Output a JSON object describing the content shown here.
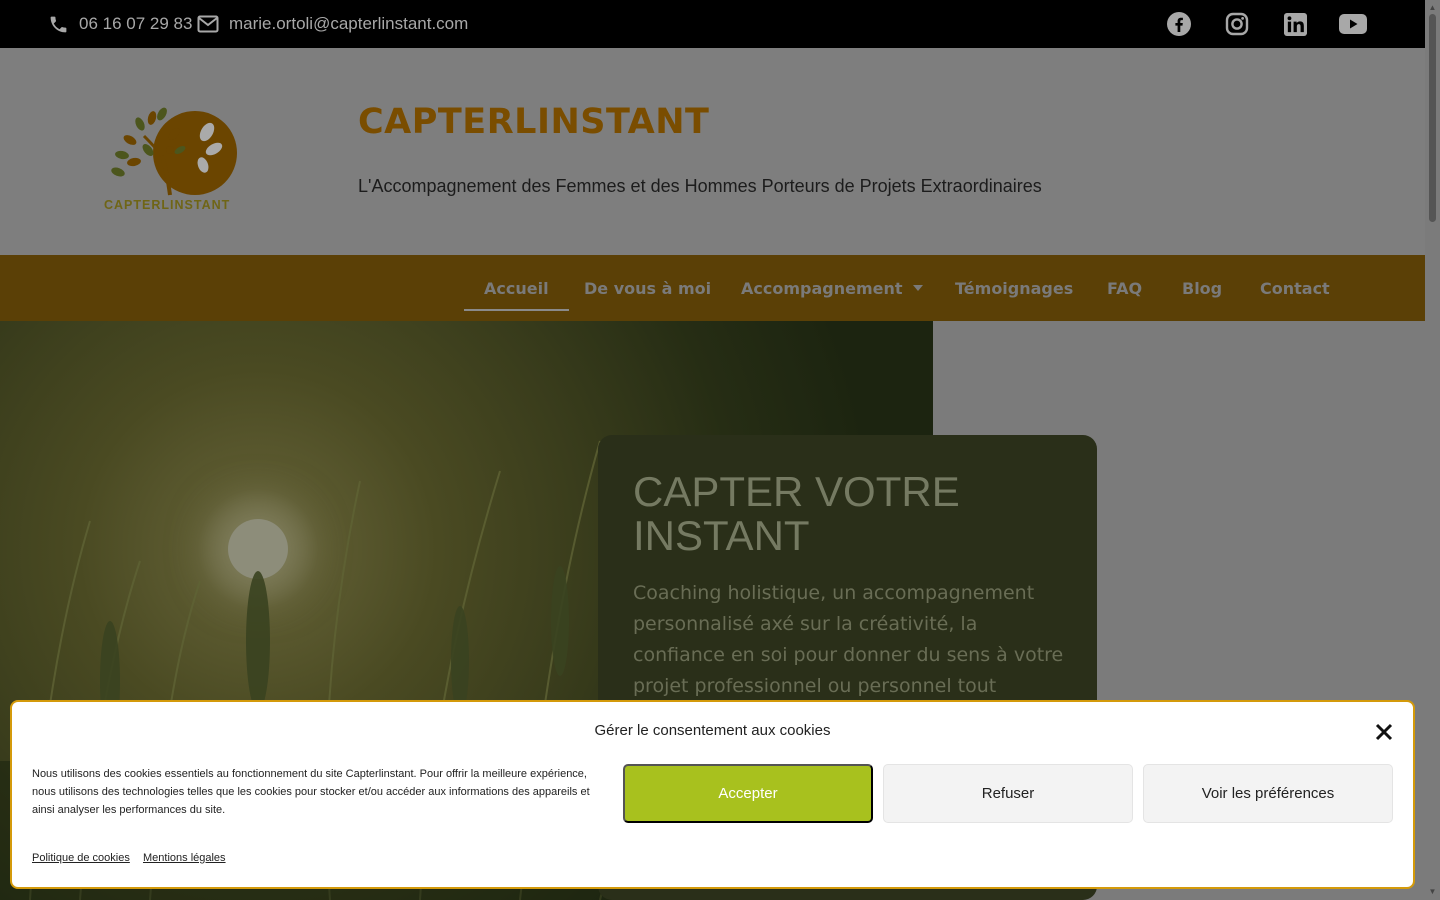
{
  "topbar": {
    "phone": "06 16 07 29 83",
    "email": "marie.ortoli@capterlinstant.com",
    "social_icons": [
      "facebook-icon",
      "instagram-icon",
      "linkedin-icon",
      "youtube-icon"
    ]
  },
  "header": {
    "logo_text": "CAPTERLINSTANT",
    "site_title": "CAPTERLINSTANT",
    "tagline": "L'Accompagnement des Femmes et des Hommes Porteurs de Projets Extraordinaires"
  },
  "nav": {
    "items": [
      {
        "label": "Accueil",
        "active": true
      },
      {
        "label": "De vous à moi"
      },
      {
        "label": "Accompagnement",
        "has_dropdown": true
      },
      {
        "label": "Témoignages"
      },
      {
        "label": "FAQ"
      },
      {
        "label": "Blog"
      },
      {
        "label": "Contact"
      }
    ]
  },
  "hero": {
    "title": "CAPTER VOTRE INSTANT",
    "text": "Coaching holistique, un accompagnement personnalisé axé sur la créativité, la confiance en soi pour donner du sens à votre projet professionnel ou personnel tout"
  },
  "cookie": {
    "title": "Gérer le consentement aux cookies",
    "text": "Nous utilisons des cookies essentiels au fonctionnement du site Capterlinstant. Pour offrir la meilleure expérience, nous utilisons des technologies telles que les cookies pour stocker et/ou accéder aux informations des appareils et ainsi analyser les performances du site.",
    "accept_label": "Accepter",
    "refuse_label": "Refuser",
    "prefs_label": "Voir les préférences",
    "policy_link": "Politique de cookies",
    "legal_link": "Mentions légales"
  },
  "colors": {
    "accent": "#a8c11e",
    "brand": "#d49a0a",
    "topbar": "#000000"
  }
}
